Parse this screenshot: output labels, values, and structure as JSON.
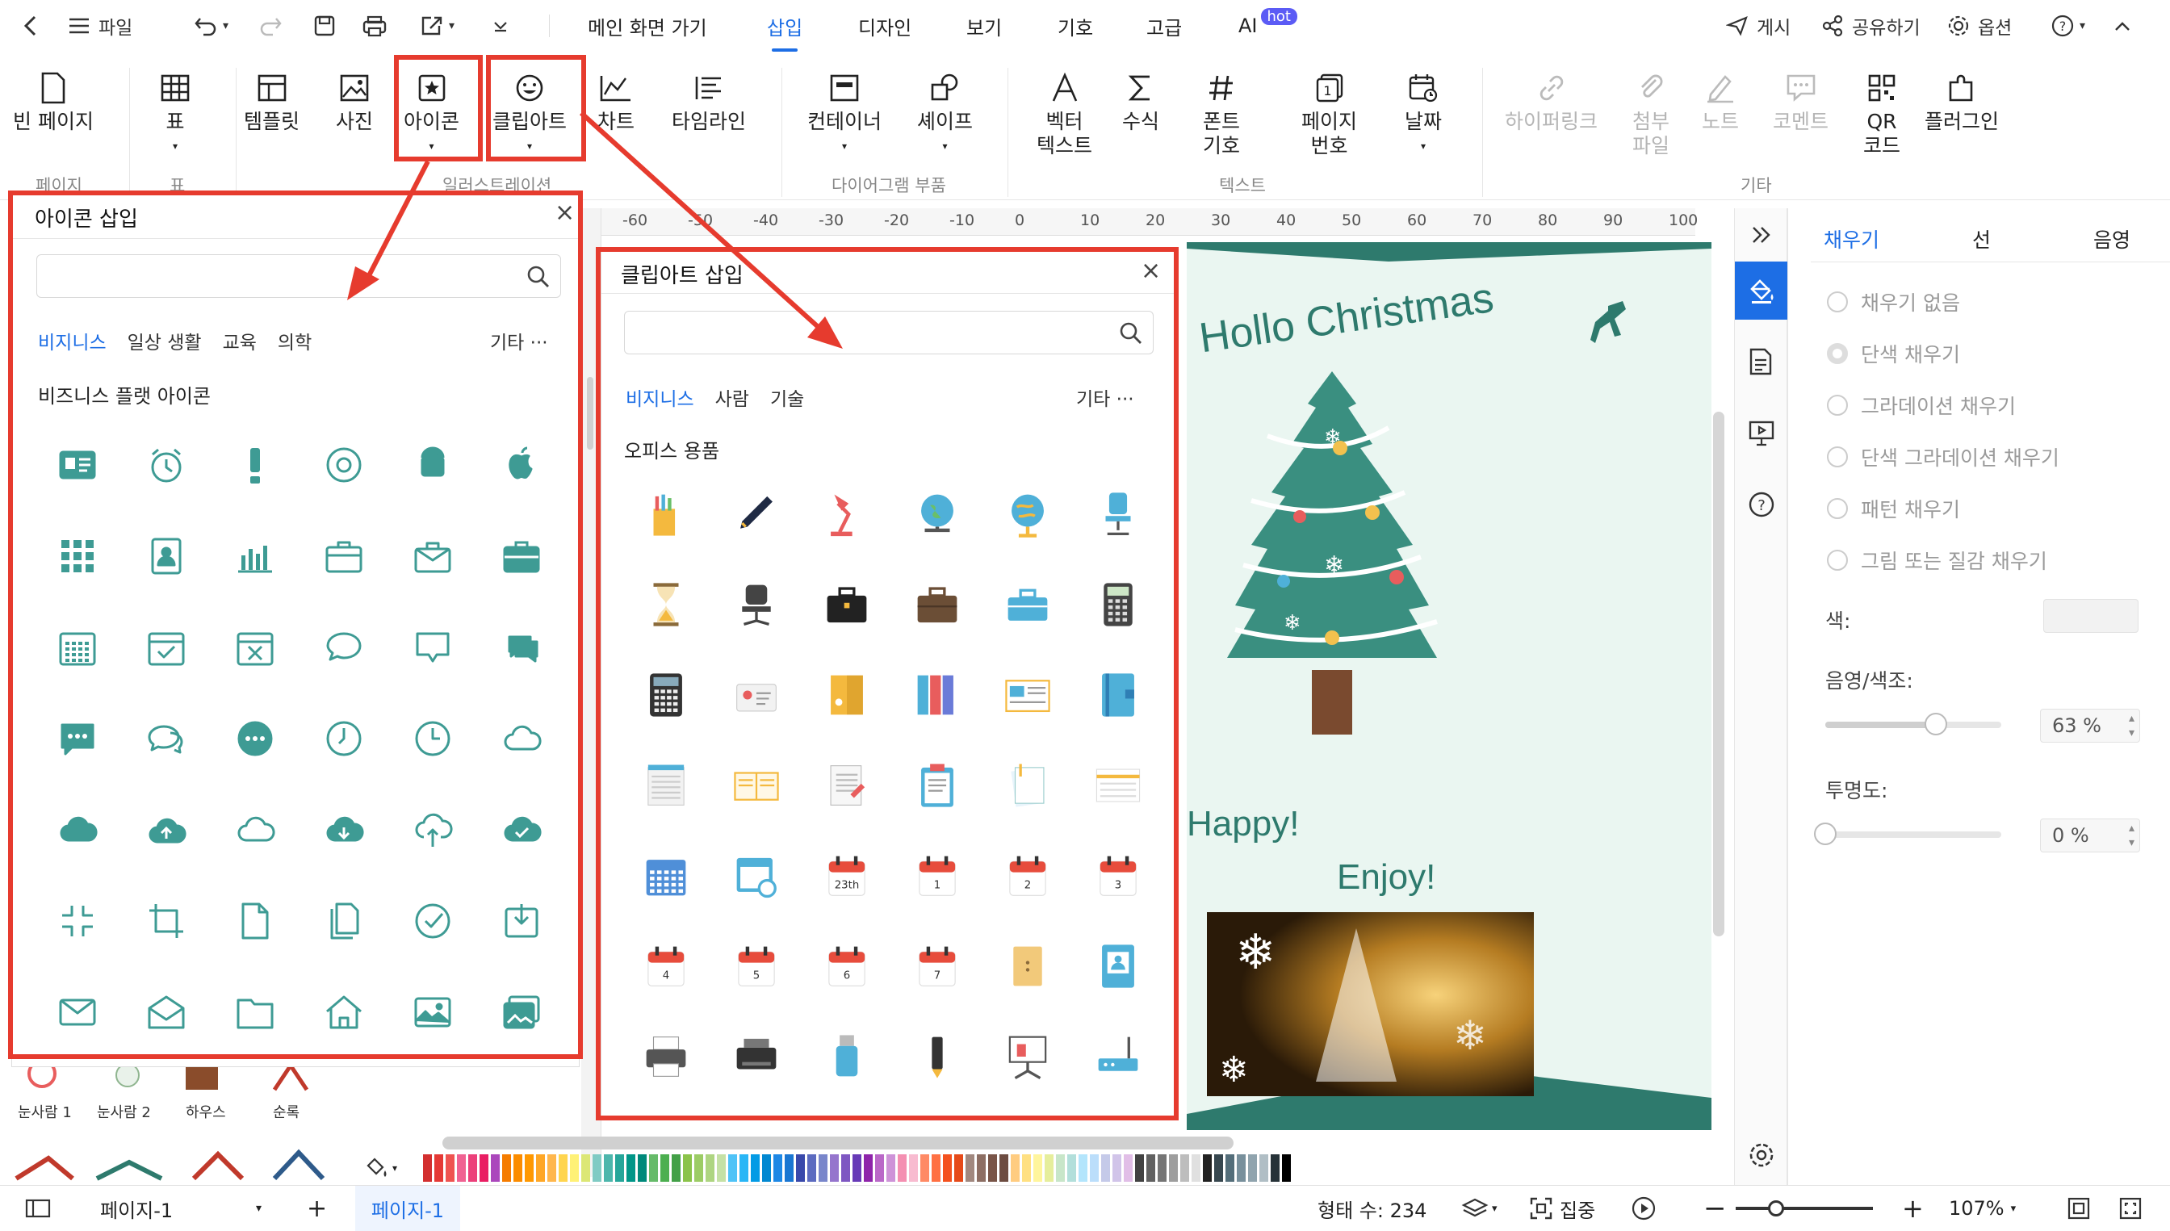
{
  "menubar": {
    "file": "파일",
    "main_view": "메인 화면 가기",
    "insert": "삽입",
    "design": "디자인",
    "view": "보기",
    "symbol": "기호",
    "advanced": "고급",
    "ai": "AI",
    "hot": "hot",
    "publish": "게시",
    "share": "공유하기",
    "options": "옵션"
  },
  "ribbon": {
    "blank_page": "빈 페이지",
    "table": "표",
    "template": "템플릿",
    "photo": "사진",
    "icon": "아이콘",
    "clipart": "클립아트",
    "chart": "차트",
    "timeline": "타임라인",
    "container": "컨테이너",
    "shape": "셰이프",
    "vector_text": "벡터\n텍스트",
    "formula": "수식",
    "font_symbol": "폰트\n기호",
    "page_number": "페이지\n번호",
    "date": "날짜",
    "hyperlink": "하이퍼링크",
    "attachment": "첨부\n파일",
    "note": "노트",
    "comment": "코멘트",
    "qr_code": "QR\n코드",
    "plugin": "플러그인",
    "groups": {
      "page": "페이지",
      "table": "표",
      "illustration": "일러스트레이션",
      "diagram_parts": "다이어그램 부품",
      "text": "텍스트",
      "other": "기타"
    }
  },
  "icon_panel": {
    "title": "아이콘 삽입",
    "tabs": [
      "비지니스",
      "일상 생활",
      "교육",
      "의학"
    ],
    "more": "기타",
    "section": "비즈니스 플랫 아이콘",
    "icons": [
      "id-card-icon",
      "alarm-clock-icon",
      "exclamation-icon",
      "at-sign-icon",
      "android-icon",
      "apple-icon",
      "grid-icon",
      "contact-book-icon",
      "bar-chart-icon",
      "briefcase-outline-icon",
      "briefcase-open-icon",
      "briefcase-icon",
      "calendar-icon",
      "calendar-check-icon",
      "calendar-x-icon",
      "speech-bubble-icon",
      "chat-callout-icon",
      "chat-bubbles-icon",
      "chat-dots-icon",
      "chat-double-icon",
      "chat-ellipsis-icon",
      "clock-icon",
      "clock-outline-icon",
      "cloud-outline-icon",
      "cloud-icon",
      "cloud-upload-icon",
      "cloud-thin-icon",
      "cloud-download-icon",
      "cloud-upload-outline-icon",
      "cloud-check-icon",
      "compress-icon",
      "crop-icon",
      "document-icon",
      "documents-icon",
      "check-circle-icon",
      "download-tray-icon",
      "mail-icon",
      "mail-open-icon",
      "folder-icon",
      "home-icon",
      "image-icon",
      "images-icon"
    ]
  },
  "clipart_panel": {
    "title": "클립아트 삽입",
    "tabs": [
      "비지니스",
      "사람",
      "기술"
    ],
    "more": "기타",
    "section": "오피스 용품",
    "cal_days": [
      "23th",
      "1",
      "2",
      "3",
      "4",
      "5",
      "6",
      "7"
    ]
  },
  "ruler": [
    "-60",
    "-50",
    "-40",
    "-30",
    "-20",
    "-10",
    "0",
    "10",
    "20",
    "30",
    "40",
    "50",
    "60",
    "70",
    "80",
    "90",
    "100"
  ],
  "card": {
    "greeting": "Hollo Christmas",
    "happy": "Happy!",
    "enjoy": "Enjoy!"
  },
  "right_panel": {
    "tabs": [
      "채우기",
      "선",
      "음영"
    ],
    "options": [
      "채우기 없음",
      "단색 채우기",
      "그라데이션 채우기",
      "단색 그라데이션 채우기",
      "패턴 채우기",
      "그림 또는 질감 채우기"
    ],
    "color_label": "색:",
    "shade_label": "음영/색조:",
    "shade_value": "63 %",
    "transparency_label": "투명도:",
    "transparency_value": "0 %",
    "shade_level": 0.63,
    "transparency_level": 0
  },
  "library": [
    "눈사람 1",
    "눈사람 2",
    "하우스",
    "순록"
  ],
  "status": {
    "page_dd": "페이지-1",
    "page_tab": "페이지-1",
    "shape_count": "형태 수: 234",
    "focus": "집중",
    "zoom": "107%"
  },
  "colors": {
    "accent": "#1d6ee5",
    "red": "#e63b2e",
    "teal": "#3e9b94",
    "tree": "#3a8f80"
  }
}
